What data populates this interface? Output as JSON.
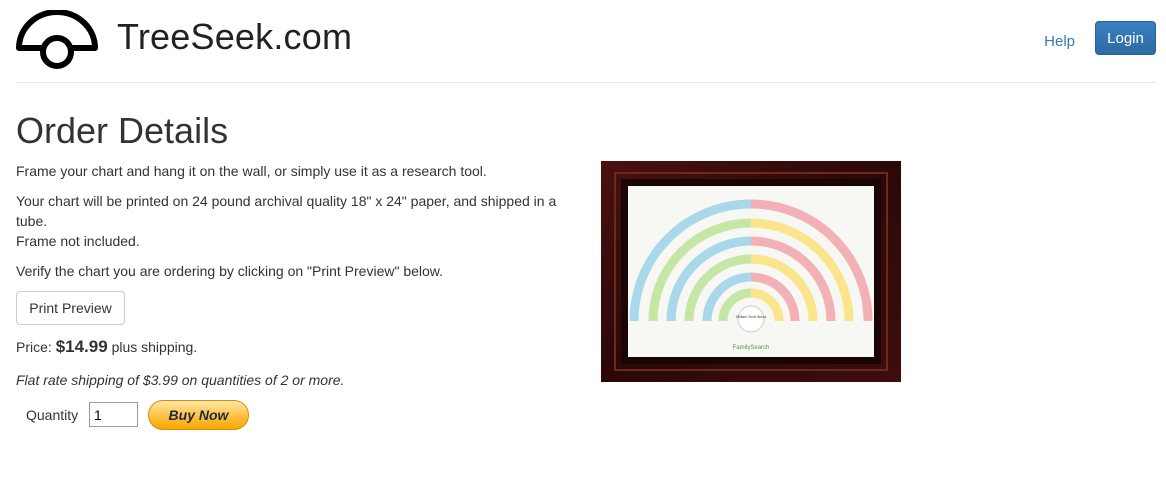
{
  "header": {
    "site_title": "TreeSeek.com",
    "help_label": "Help",
    "login_label": "Login"
  },
  "main": {
    "title": "Order Details",
    "desc1": "Frame your chart and hang it on the wall, or simply use it as a research tool.",
    "desc2a": "Your chart will be printed on 24 pound archival quality 18\" x 24\" paper, and shipped in a tube.",
    "desc2b": "Frame not included.",
    "desc3": "Verify the chart you are ordering by clicking on \"Print Preview\" below.",
    "preview_label": "Print Preview",
    "price_prefix": "Price:",
    "price_value": "$14.99",
    "price_suffix": "plus shipping.",
    "shipping_note": "Flat rate shipping of $3.99 on quantities of 2 or more.",
    "quantity_label": "Quantity",
    "quantity_value": "1",
    "buy_label": "Buy Now"
  },
  "image": {
    "center_text": "William Scott Wood",
    "brand_text": "FamilySearch"
  },
  "colors": {
    "link": "#337ab7",
    "primary_button": "#2e6da4",
    "buy_button": "#ffc34a",
    "frame_wood": "#3a0c0c"
  }
}
